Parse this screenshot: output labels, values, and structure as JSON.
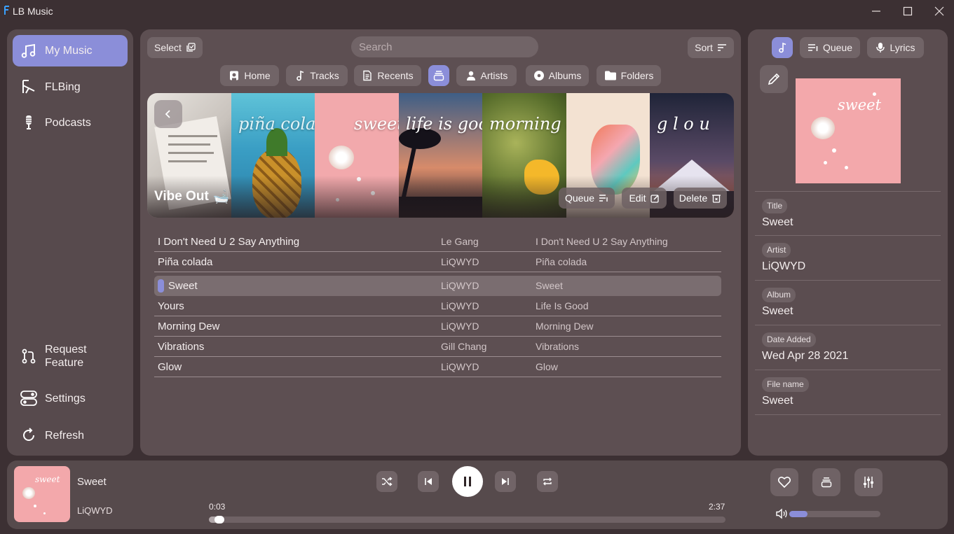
{
  "window": {
    "title": "LB Music",
    "logo_letter": "F"
  },
  "sidebar": {
    "items": [
      {
        "label": "My Music",
        "icon": "music-notes-icon",
        "active": true
      },
      {
        "label": "FLBing",
        "icon": "flbing-icon"
      },
      {
        "label": "Podcasts",
        "icon": "microphone-icon"
      }
    ],
    "bottom_items": [
      {
        "label": "Request Feature",
        "icon": "pull-request-icon"
      },
      {
        "label": "Settings",
        "icon": "toggle-settings-icon"
      },
      {
        "label": "Refresh",
        "icon": "refresh-icon"
      }
    ]
  },
  "main": {
    "select_label": "Select",
    "search_placeholder": "Search",
    "sort_label": "Sort",
    "tabs": [
      {
        "label": "Home",
        "icon": "home-icon"
      },
      {
        "label": "Tracks",
        "icon": "note-icon"
      },
      {
        "label": "Recents",
        "icon": "document-icon"
      },
      {
        "label": "",
        "icon": "playlist-icon",
        "active": true
      },
      {
        "label": "Artists",
        "icon": "person-icon"
      },
      {
        "label": "Albums",
        "icon": "disc-icon"
      },
      {
        "label": "Folders",
        "icon": "folder-icon"
      }
    ],
    "banner": {
      "title": "Vibe Out",
      "title_emoji": "🛁",
      "tiles": [
        "",
        "piña cola",
        "sweet",
        "life is goo",
        "morning d",
        "",
        "g l o u"
      ],
      "queue_label": "Queue",
      "edit_label": "Edit",
      "delete_label": "Delete"
    },
    "tracks": [
      {
        "title": "I Don't Need U 2 Say Anything",
        "artist": "Le Gang",
        "album": "I Don't Need U 2 Say Anything"
      },
      {
        "title": "Piña colada",
        "artist": "LiQWYD",
        "album": "Piña colada"
      },
      {
        "title": "Sweet",
        "artist": "LiQWYD",
        "album": "Sweet",
        "playing": true
      },
      {
        "title": "Yours",
        "artist": "LiQWYD",
        "album": "Life Is Good"
      },
      {
        "title": "Morning Dew",
        "artist": "LiQWYD",
        "album": "Morning Dew"
      },
      {
        "title": "Vibrations",
        "artist": "Gill Chang",
        "album": "Vibrations"
      },
      {
        "title": "Glow",
        "artist": "LiQWYD",
        "album": "Glow"
      }
    ]
  },
  "right_panel": {
    "queue_label": "Queue",
    "lyrics_label": "Lyrics",
    "cover_text": "sweet",
    "info": [
      {
        "label": "Title",
        "value": "Sweet"
      },
      {
        "label": "Artist",
        "value": "LiQWYD"
      },
      {
        "label": "Album",
        "value": "Sweet"
      },
      {
        "label": "Date Added",
        "value": "Wed Apr 28 2021"
      },
      {
        "label": "File name",
        "value": "Sweet"
      }
    ]
  },
  "player": {
    "title": "Sweet",
    "artist": "LiQWYD",
    "cover_text": "sweet",
    "elapsed": "0:03",
    "duration": "2:37",
    "progress": 0.02,
    "volume": 0.2
  },
  "colors": {
    "accent": "#8b8ed9",
    "panel": "#5d4f52",
    "background": "#3c3033"
  }
}
